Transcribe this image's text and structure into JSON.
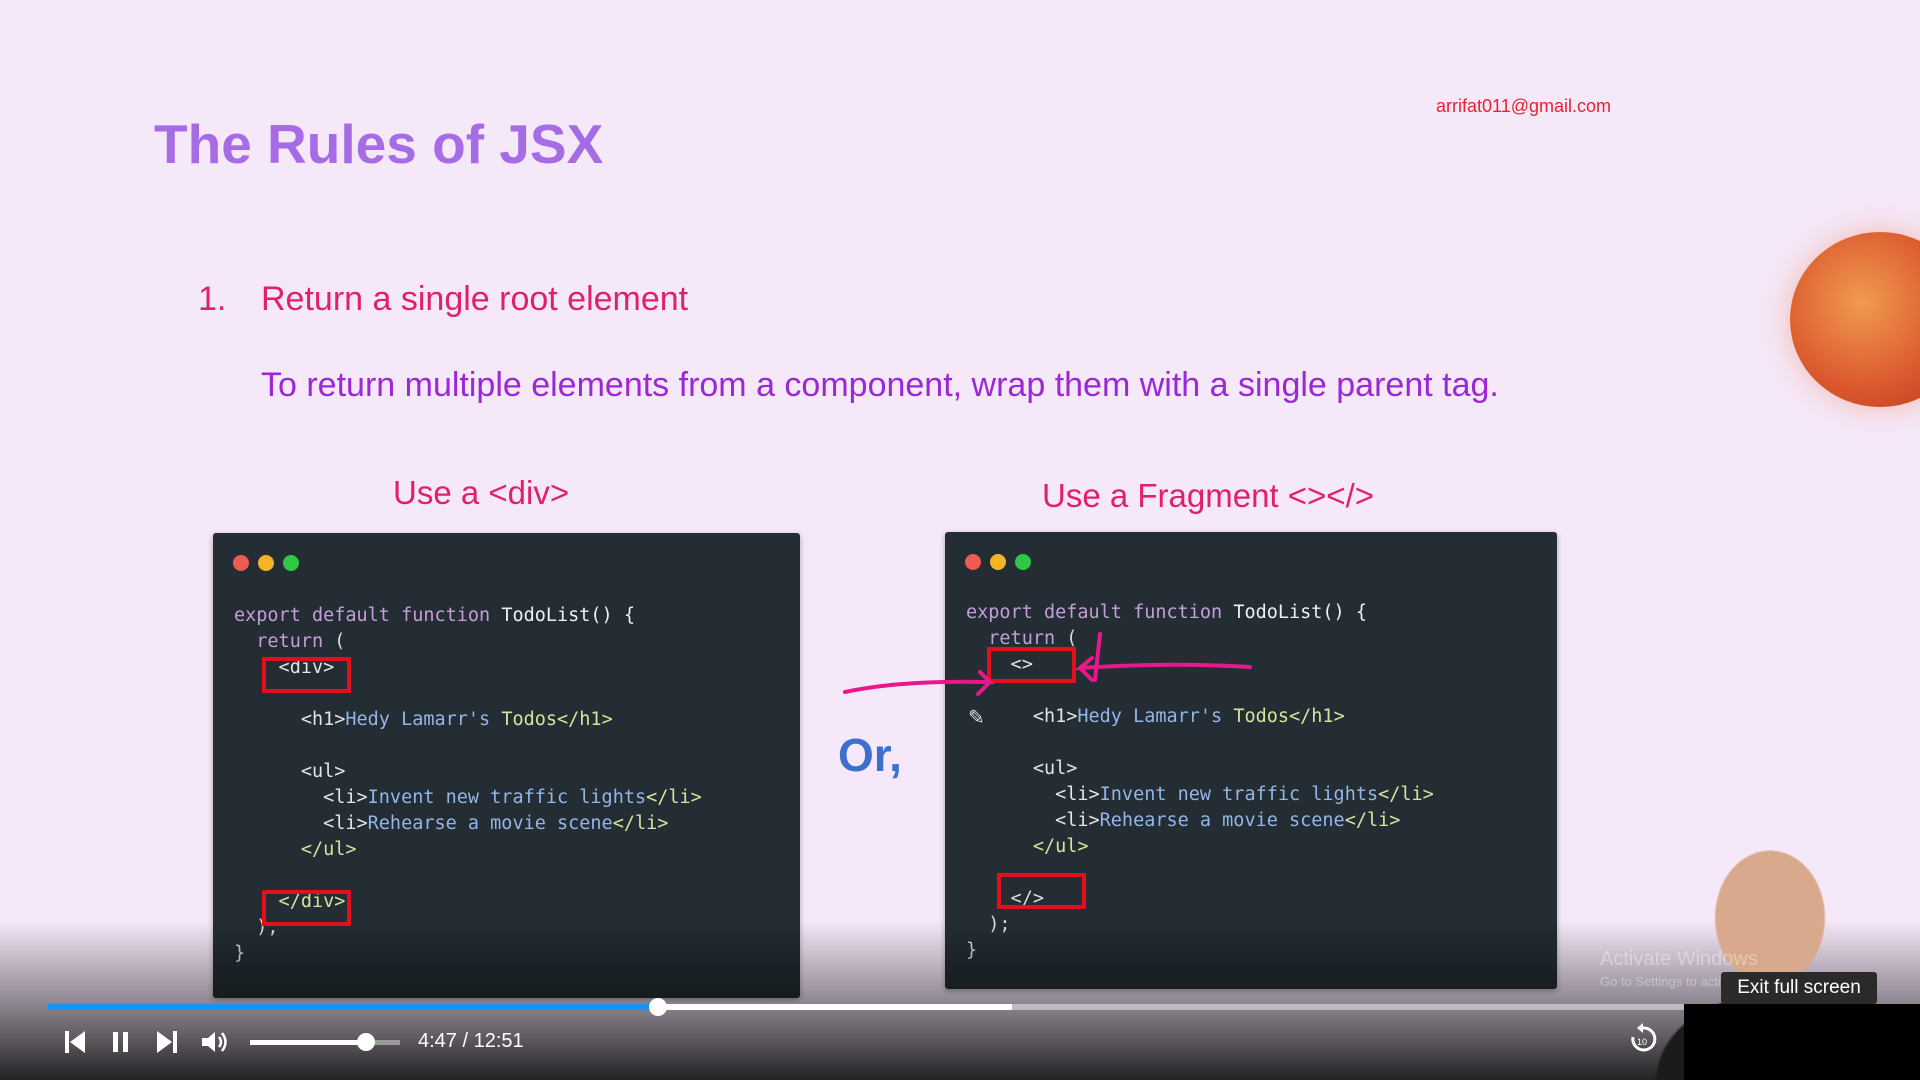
{
  "slide": {
    "title": "The Rules of JSX",
    "email": "arrifat011@gmail.com",
    "rule_number": "1.",
    "rule_title": "Return a single root element",
    "rule_description": "To return multiple elements from a component, wrap them with a single parent tag.",
    "option_div_label": "Use a <div>",
    "option_fragment_label": "Use a Fragment <></>",
    "or_label": "Or,",
    "traffic_light_colors": [
      "#ee5b55",
      "#f3b428",
      "#2ec845"
    ],
    "code_div": [
      [
        [
          "kw",
          "export default function "
        ],
        [
          "fn",
          "TodoList() {"
        ]
      ],
      [
        [
          "kw",
          "  return "
        ],
        [
          "pl",
          "("
        ]
      ],
      [
        [
          "tg",
          "    <div>"
        ]
      ],
      [],
      [
        [
          "tg",
          "      <h1>"
        ],
        [
          "tx",
          "Hedy Lamarr's "
        ],
        [
          "gr",
          "Todos</h1>"
        ]
      ],
      [],
      [
        [
          "tg",
          "      <ul>"
        ]
      ],
      [
        [
          "tg",
          "        <li>"
        ],
        [
          "tx",
          "Invent new traffic lights"
        ],
        [
          "gr",
          "</li>"
        ]
      ],
      [
        [
          "tg",
          "        <li>"
        ],
        [
          "tx",
          "Rehearse a movie scene"
        ],
        [
          "gr",
          "</li>"
        ]
      ],
      [
        [
          "gr",
          "      </ul>"
        ]
      ],
      [],
      [
        [
          "gr",
          "    </div>"
        ]
      ],
      [
        [
          "pl",
          "  );"
        ]
      ],
      [
        [
          "pl",
          "}"
        ]
      ]
    ],
    "code_fragment": [
      [
        [
          "kw",
          "export default function "
        ],
        [
          "fn",
          "TodoList() {"
        ]
      ],
      [
        [
          "kw",
          "  return "
        ],
        [
          "pl",
          "("
        ]
      ],
      [
        [
          "tg",
          "    <>"
        ]
      ],
      [],
      [
        [
          "tg",
          "      <h1>"
        ],
        [
          "tx",
          "Hedy Lamarr's "
        ],
        [
          "gr",
          "Todos</h1>"
        ]
      ],
      [],
      [
        [
          "tg",
          "      <ul>"
        ]
      ],
      [
        [
          "tg",
          "        <li>"
        ],
        [
          "tx",
          "Invent new traffic lights"
        ],
        [
          "gr",
          "</li>"
        ]
      ],
      [
        [
          "tg",
          "        <li>"
        ],
        [
          "tx",
          "Rehearse a movie scene"
        ],
        [
          "gr",
          "</li>"
        ]
      ],
      [
        [
          "gr",
          "      </ul>"
        ]
      ],
      [],
      [
        [
          "pl",
          "    </>"
        ]
      ],
      [
        [
          "pl",
          "  );"
        ]
      ],
      [
        [
          "pl",
          "}"
        ]
      ]
    ],
    "annotation_color": "#e8188a",
    "highlight_color": "#e3101c"
  },
  "overlay": {
    "watermark_title": "Activate Windows",
    "watermark_subtitle": "Go to Settings to activate Windows.",
    "tooltip": "Exit full screen"
  },
  "player": {
    "current_time": "4:47",
    "duration": "12:51",
    "time_display": "4:47 / 12:51",
    "progress_percent": 37.3,
    "buffered_percent": 58.9,
    "volume_percent": 77,
    "accent_color": "#1594f5",
    "icons": [
      "previous-icon",
      "pause-icon",
      "next-icon",
      "volume-icon",
      "replay-10-icon"
    ]
  }
}
